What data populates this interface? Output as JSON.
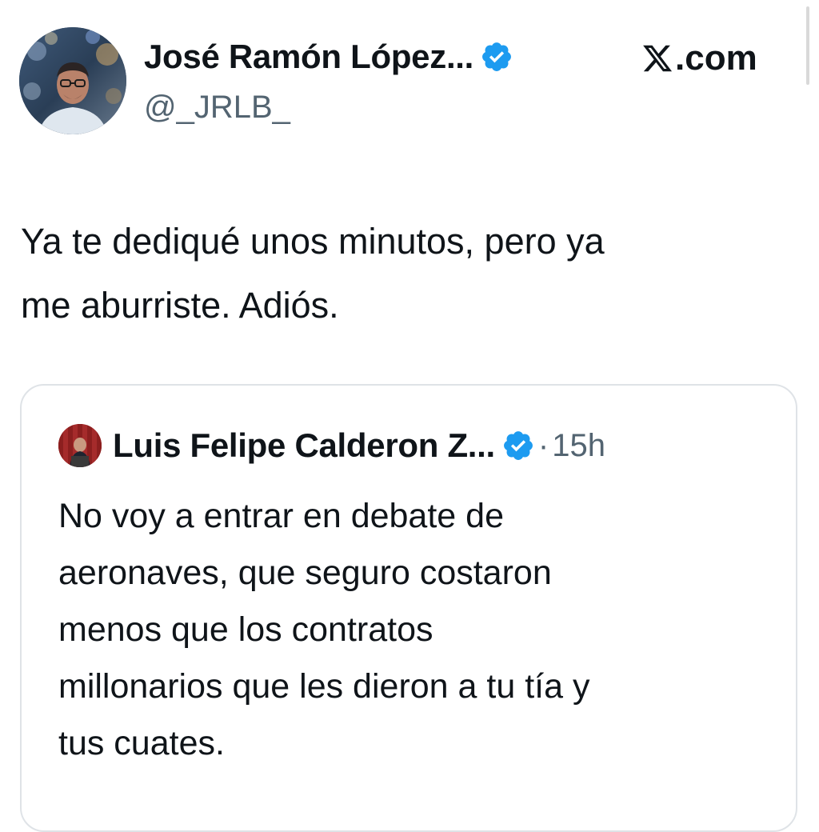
{
  "site": {
    "label": ".com",
    "logo_icon": "x-logo-icon"
  },
  "tweet": {
    "author_name": "José Ramón López...",
    "author_handle": "@_JRLB_",
    "verified_icon": "verified-badge-icon",
    "text": "Ya te dediqué unos minutos, pero ya\nme aburriste. Adiós."
  },
  "quoted_tweet": {
    "author_name": "Luis Felipe Calderon Z...",
    "verified_icon": "verified-badge-icon",
    "separator": "·",
    "time": "15h",
    "text": "No voy a entrar en debate de\naeronaves, que seguro costaron\nmenos que los contratos\nmillonarios que les dieron a tu tía y\ntus cuates."
  },
  "colors": {
    "verified_blue": "#1d9bf0",
    "text_primary": "#0f1419",
    "text_secondary": "#536471",
    "card_border": "#dfe3e7"
  }
}
